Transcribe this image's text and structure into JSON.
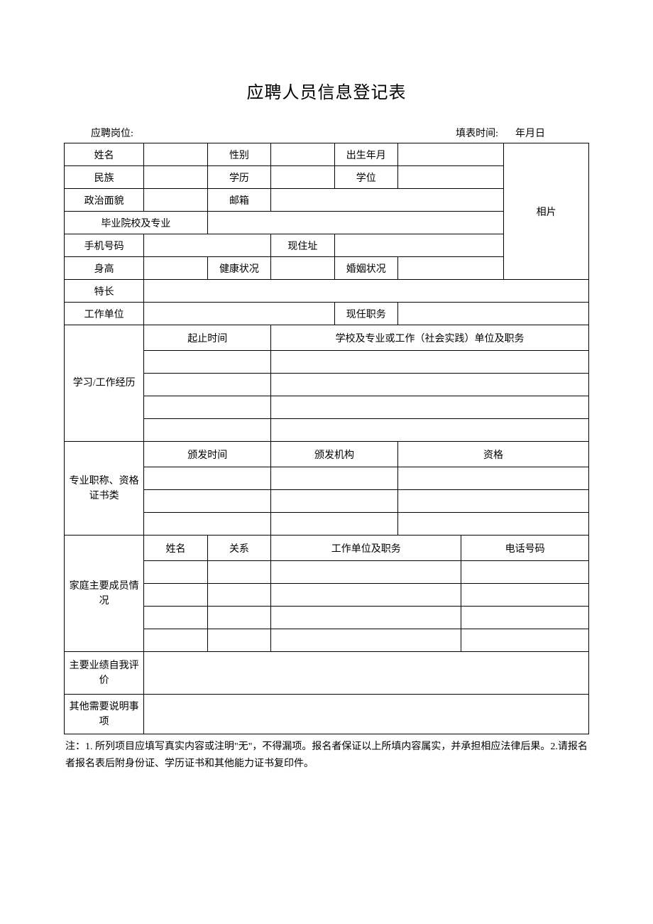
{
  "title": "应聘人员信息登记表",
  "header": {
    "position_label": "应聘岗位:",
    "fill_time_label": "填表时间:",
    "date_suffix": "年月日"
  },
  "labels": {
    "name": "姓名",
    "gender": "性别",
    "birth": "出生年月",
    "ethnic": "民族",
    "education": "学历",
    "degree": "学位",
    "political": "政治面貌",
    "email": "邮箱",
    "photo": "相片",
    "school_major": "毕业院校及专业",
    "phone": "手机号码",
    "current_address": "现住址",
    "height": "身高",
    "health": "健康状况",
    "marital": "婚姻状况",
    "specialty": "特长",
    "work_unit": "工作单位",
    "current_position": "现任职务",
    "study_work_history": "学习/工作经历",
    "period": "起止时间",
    "school_or_work": "学校及专业或工作（社会实践）单位及职务",
    "certificates": "专业职称、资格证书类",
    "cert_issue_time": "颁发时间",
    "cert_issuer": "颁发机构",
    "cert_qualification": "资格",
    "family": "家庭主要成员情况",
    "family_name": "姓名",
    "family_relation": "关系",
    "family_work": "工作单位及职务",
    "family_phone": "电话号码",
    "self_eval": "主要业绩自我评价",
    "other_notes": "其他需要说明事项"
  },
  "notes": "注：1. 所列项目应填写真实内容或注明\"无\"，不得漏项。报名者保证以上所填内容属实，并承担相应法律后果。2.请报名者报名表后附身份证、学历证书和其他能力证书复印件。"
}
